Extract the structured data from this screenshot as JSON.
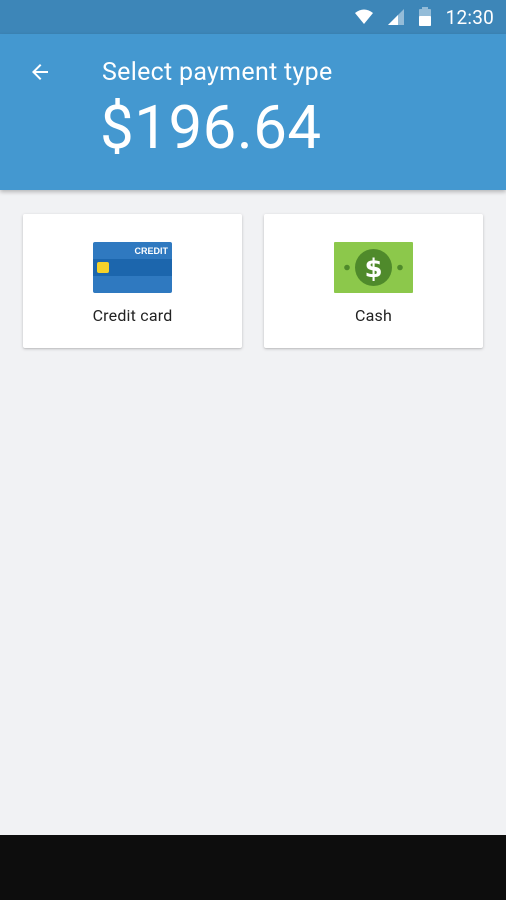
{
  "status_bar": {
    "time": "12:30",
    "icons": [
      "wifi-icon",
      "signal-icon",
      "battery-icon"
    ]
  },
  "header": {
    "title": "Select payment type",
    "amount": "$196.64",
    "back_icon": "arrow-back-icon"
  },
  "payment_options": [
    {
      "label": "Credit card",
      "icon": "credit-card-icon",
      "icon_text": "CREDIT"
    },
    {
      "label": "Cash",
      "icon": "cash-icon",
      "icon_text": "$"
    }
  ],
  "colors": {
    "status_bar": "#3d86b8",
    "app_bar": "#4498d0",
    "background": "#f1f2f4",
    "card": "#ffffff",
    "credit_card_blue": "#2f79c0",
    "credit_card_chip": "#f5d22a",
    "cash_green": "#8cc84b",
    "cash_dark_green": "#4f8a2b",
    "nav_bar": "#0d0d0d"
  }
}
